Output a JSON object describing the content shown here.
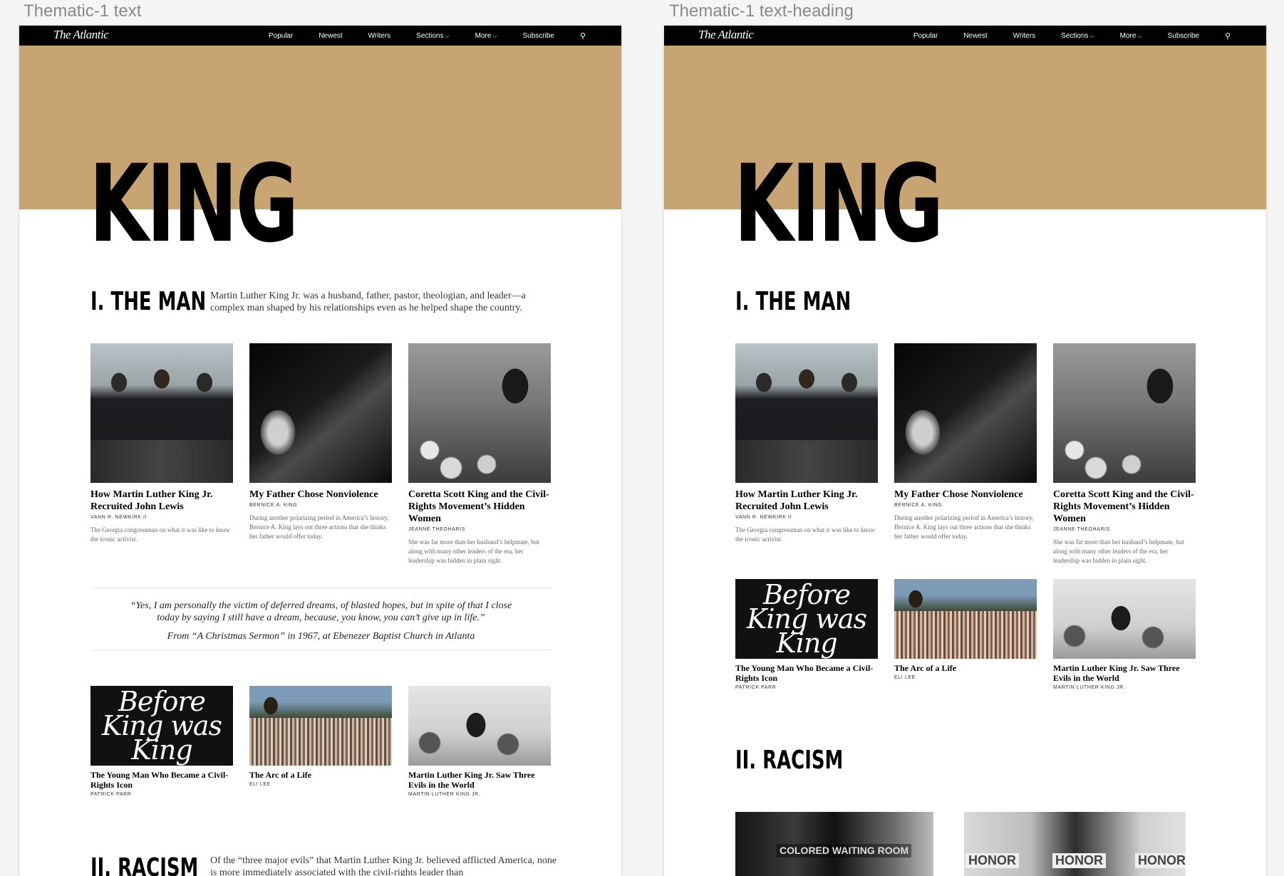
{
  "frames": [
    {
      "label": "Thematic-1 text"
    },
    {
      "label": "Thematic-1 text-heading"
    }
  ],
  "nav": {
    "logo": "The Atlantic",
    "links": [
      "Popular",
      "Newest",
      "Writers",
      "Sections",
      "More",
      "Subscribe"
    ],
    "search_icon": "search-icon"
  },
  "colors": {
    "hero": "#c8a473",
    "nav": "#000000"
  },
  "hero": {
    "title": "KING"
  },
  "section1": {
    "title": "I. THE MAN",
    "intro": "Martin Luther King Jr. was a husband, father, pastor, theologian, and leader—a complex man shaped by his relationships even as he helped shape the country."
  },
  "section2": {
    "title": "II. RACISM",
    "intro": "Of the “three major evils” that Martin Luther King Jr. believed afflicted America, none is more immediately associated with the civil-rights leader than"
  },
  "featured": [
    {
      "title": "How Martin Luther King Jr. Recruited John Lewis",
      "byline": "VANN R. NEWKIRK II",
      "dek": "The Georgia congressman on what it was like to know the iconic activist."
    },
    {
      "title": "My Father Chose Nonviolence",
      "byline": "BERNICE A. KING",
      "dek": "During another polarizing period in America’s history, Bernice A. King lays out three actions that she thinks her father would offer today."
    },
    {
      "title": "Coretta Scott King and the Civil-Rights Movement’s Hidden Women",
      "byline": "JEANNE THEOHARIS",
      "dek": "She was far more than her husband’s helpmate, but along with many other leaders of the era, her leadership was hidden in plain sight."
    }
  ],
  "quote": {
    "text": "“Yes, I am personally the victim of deferred dreams, of blasted hopes, but in spite of that I close today by saying I still have a dream, because, you know, you can’t give up in life.”",
    "source": "From “A Christmas Sermon” in 1967, at Ebenezer Baptist Church in Atlanta"
  },
  "secondary": [
    {
      "title": "The Young Man Who Became a Civil-Rights Icon",
      "byline": "PATRICK PARR",
      "art": "Before King was King"
    },
    {
      "title": "The Arc of a Life",
      "byline": "ELI LEE"
    },
    {
      "title": "Martin Luther King Jr. Saw Three Evils in the World",
      "byline": "MARTIN LUTHER KING JR."
    }
  ],
  "racism_photos": {
    "sign": "COLORED WAITING ROOM",
    "honor": "HONOR"
  }
}
